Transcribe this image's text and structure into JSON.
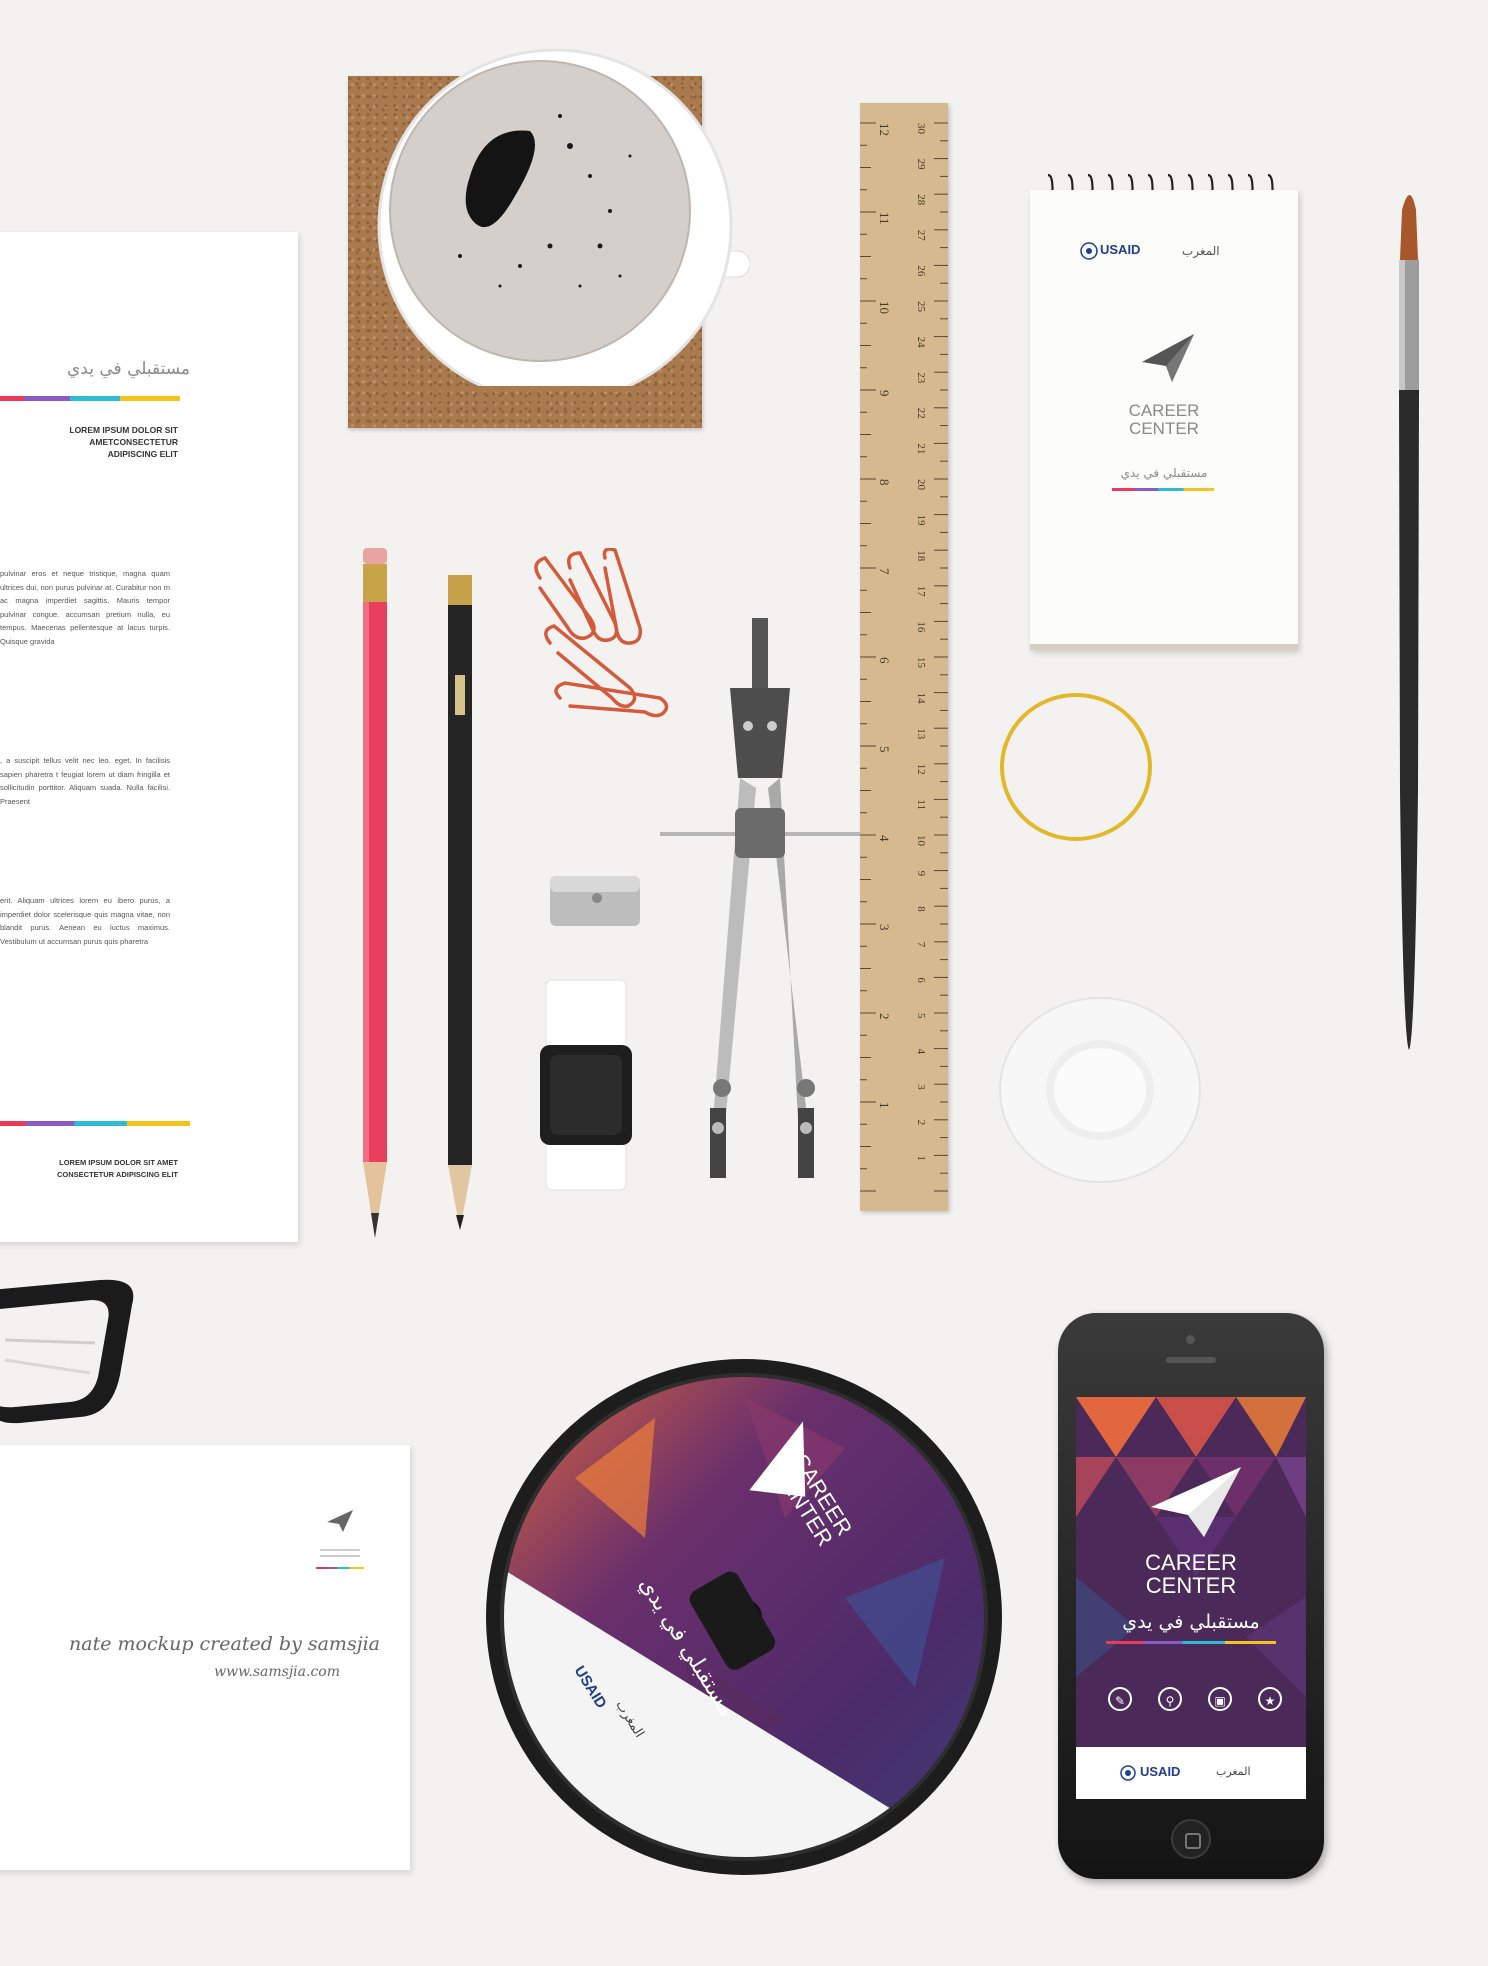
{
  "letterhead": {
    "arabic_title": "مستقبلي في يدي",
    "address_block": "LOREM IPSUM DOLOR SIT\nAMETCONSECTETUR\nADIPISCING ELIT",
    "paragraph_1": "pulvinar eros et neque tristique, magna quam ultrices dui, non purus pulvinar at. Curabitur non m ac magna imperdiet sagittis. Mauris tempor pulvinar congue. accumsan pretium nulla, eu tempus. Maecenas pellentesque at lacus turpis. Quisque gravida",
    "paragraph_2": ", a suscipit tellus velit nec leo. eget. In facilisis sapien pharetra t feugiat lorem ut diam fringilla et sollicitudin porttitor. Aliquam suada. Nulla facilisi. Praesent",
    "paragraph_3": "erit. Aliquam ultrices lorem eu ibero purus, a imperdiet dolor scelerisque quis magna vitae, non blandit purus. Aenean eu luctus maximus. Vestibulum ut accumsan purus quis pharetra",
    "footer": "LOREM IPSUM DOLOR SIT AMET\nCONSECTETUR ADIPISCING ELIT"
  },
  "envelope": {
    "credit_line_1": "nate mockup created by samsjia",
    "credit_line_2": "www.samsjia.com"
  },
  "notepad": {
    "usaid": "USAID",
    "arabic_country": "المغرب",
    "career_center": "CAREER\nCENTER",
    "arabic_tagline": "مستقبلي في يدي"
  },
  "cd": {
    "career_center": "CAREER\nCENTER",
    "arabic_tagline": "مستقبلي في يدي",
    "usaid": "USAID",
    "arabic_country": "المغرب"
  },
  "phone": {
    "career_center": "CAREER\nCENTER",
    "arabic_tagline": "مستقبلي في يدي",
    "usaid": "USAID",
    "arabic_country": "المغرب"
  },
  "ruler": {
    "inch_labels": [
      "1",
      "2",
      "3",
      "4",
      "5",
      "6",
      "7",
      "8",
      "9",
      "10",
      "11",
      "12"
    ],
    "cm_labels": [
      "1",
      "2",
      "3",
      "4",
      "5",
      "6",
      "7",
      "8",
      "9",
      "10",
      "11",
      "12",
      "13",
      "14",
      "15",
      "16",
      "17",
      "18",
      "19",
      "20",
      "21",
      "22",
      "23",
      "24",
      "25",
      "26",
      "27",
      "28",
      "29",
      "30"
    ]
  },
  "colors": {
    "rainbow_red": "#e93a5c",
    "rainbow_purple": "#8b5bc5",
    "rainbow_cyan": "#2ebbd3",
    "rainbow_yellow": "#f3c51b",
    "usaid_blue": "#1f3f8a"
  }
}
